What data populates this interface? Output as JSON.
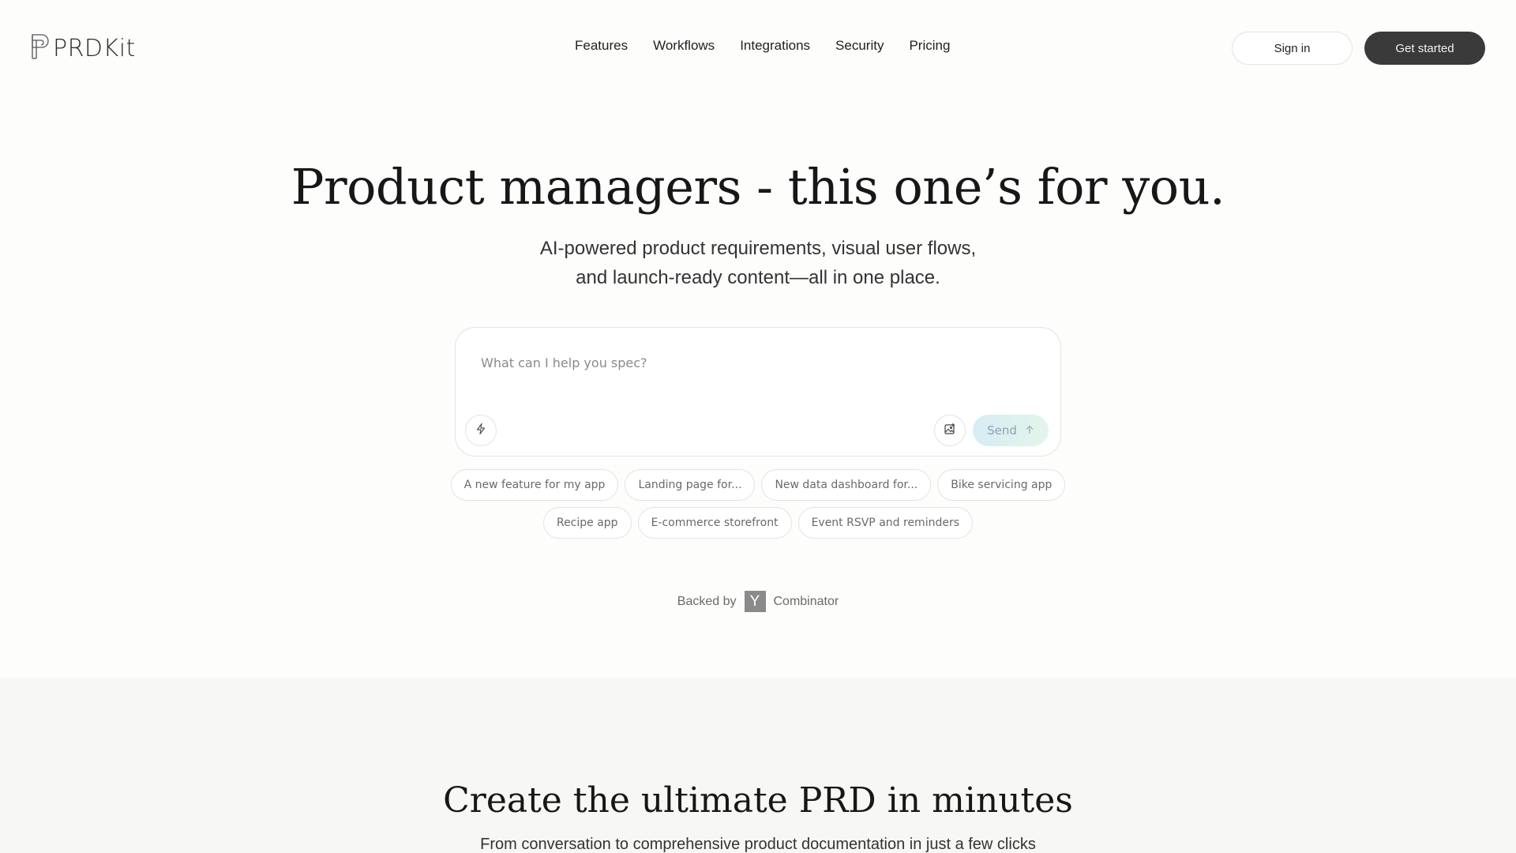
{
  "brand": {
    "name": "PRDKit",
    "logo_icon": "prdkit-logo-icon"
  },
  "nav": {
    "items": [
      {
        "label": "Features"
      },
      {
        "label": "Workflows"
      },
      {
        "label": "Integrations"
      },
      {
        "label": "Security"
      },
      {
        "label": "Pricing"
      }
    ]
  },
  "auth": {
    "signin_label": "Sign in",
    "getstarted_label": "Get started"
  },
  "hero": {
    "title": "Product managers - this one’s for you.",
    "subtitle_line1": "AI-powered product requirements, visual user flows,",
    "subtitle_line2": "and launch-ready content—all in one place."
  },
  "prompt": {
    "placeholder": "What can I help you spec?",
    "value": "",
    "send_label": "Send",
    "icons": {
      "left": "bolt-icon",
      "attach": "image-upload-icon",
      "send": "arrow-up-icon"
    }
  },
  "suggestions": {
    "row1": [
      "A new feature for my app",
      "Landing page for...",
      "New data dashboard for...",
      "Bike servicing app"
    ],
    "row2": [
      "Recipe app",
      "E-commerce storefront",
      "Event RSVP and reminders"
    ]
  },
  "backed": {
    "prefix": "Backed by",
    "logo_letter": "Y",
    "suffix": "Combinator"
  },
  "section2": {
    "title": "Create the ultimate PRD in minutes",
    "subtitle": "From conversation to comprehensive product documentation in just a few clicks"
  },
  "colors": {
    "background": "#fdfdfc",
    "primary_button": "#3a3a3a",
    "send_gradient_start": "#d7ecf5",
    "send_gradient_end": "#e3f5ea",
    "section2_background": "#f7f7f5"
  }
}
